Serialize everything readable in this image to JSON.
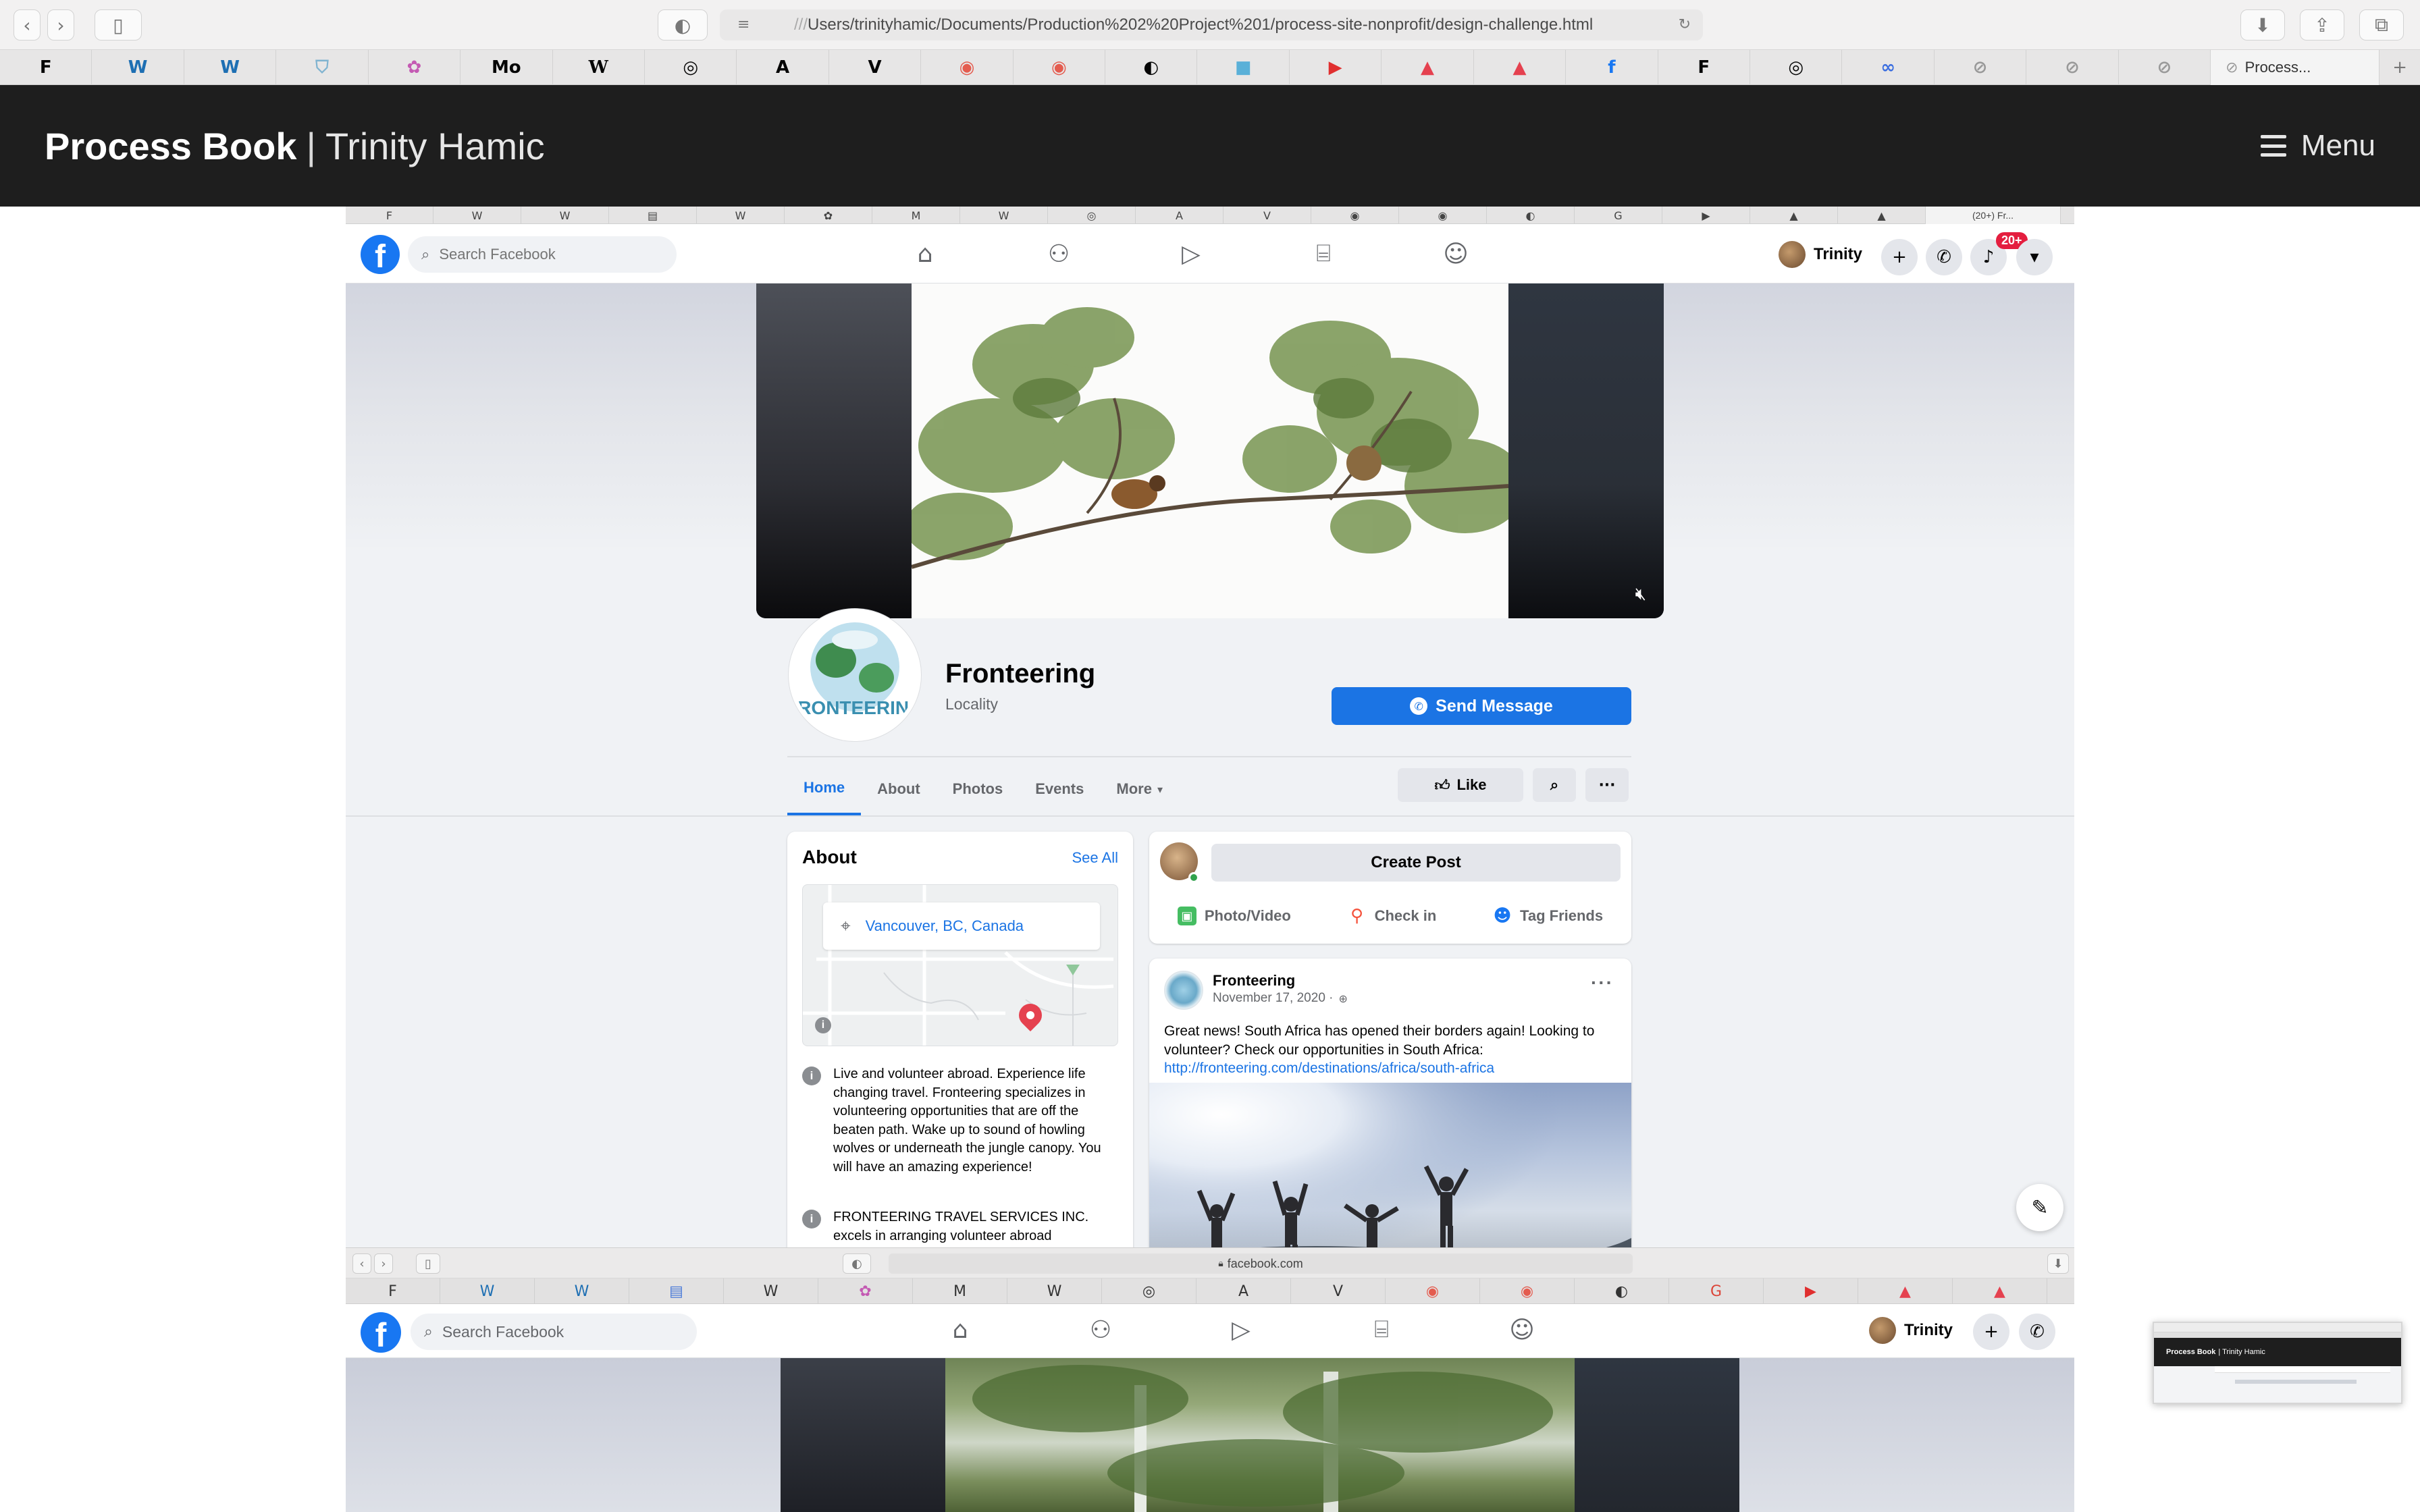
{
  "browser": {
    "url_prefix": "///",
    "url_path": "Users/trinityhamic/Documents/Production%202%20Project%201/process-site-nonprofit/design-challenge.html",
    "favorites": [
      "F",
      "W",
      "W",
      "⛉",
      "✿",
      "Mo",
      "W",
      "◎",
      "A",
      "V",
      "◉",
      "◉",
      "◐",
      "■",
      "▶",
      "▲",
      "▲",
      "f",
      "F",
      "◎",
      "∞",
      "⊘",
      "⊘",
      "⊘"
    ],
    "active_tab_label": "Process...",
    "new_tab": "+"
  },
  "site": {
    "title_bold": "Process Book",
    "separator": "|",
    "title_name": "Trinity Hamic",
    "menu_label": "Menu"
  },
  "embedded": {
    "mini_tab_label": "(20+) Fr...",
    "fb_nav": {
      "logo": "f",
      "search_placeholder": "Search Facebook",
      "user_name": "Trinity",
      "notification_count": "20+"
    },
    "page": {
      "name": "Fronteering",
      "category": "Locality",
      "send_message_label": "Send Message",
      "tabs": [
        "Home",
        "About",
        "Photos",
        "Events",
        "More"
      ],
      "like_label": "Like",
      "about": {
        "title": "About",
        "see_all": "See All",
        "location": "Vancouver, BC, Canada",
        "description": "Live and volunteer abroad. Experience life changing travel. Fronteering specializes in volunteering opportunities that are off the beaten path. Wake up to sound of howling wolves or underneath the jungle canopy. You will have an amazing experience!",
        "company": "FRONTEERING TRAVEL SERVICES INC. excels in arranging volunteer abroad"
      },
      "create": {
        "button": "Create Post",
        "actions": [
          "Photo/Video",
          "Check in",
          "Tag Friends"
        ]
      },
      "post": {
        "author": "Fronteering",
        "date": "November 17, 2020 ·",
        "text": "Great news! South Africa has opened their borders again! Looking to volunteer? Check our opportunities in South Africa:",
        "link": "http://fronteering.com/destinations/africa/south-africa"
      }
    },
    "second_browser": {
      "url": "facebook.com",
      "search_placeholder": "Search Facebook",
      "user_name": "Trinity"
    }
  },
  "thumbnail": {
    "title_bold": "Process Book",
    "title_rest": "| Trinity Hamic"
  }
}
